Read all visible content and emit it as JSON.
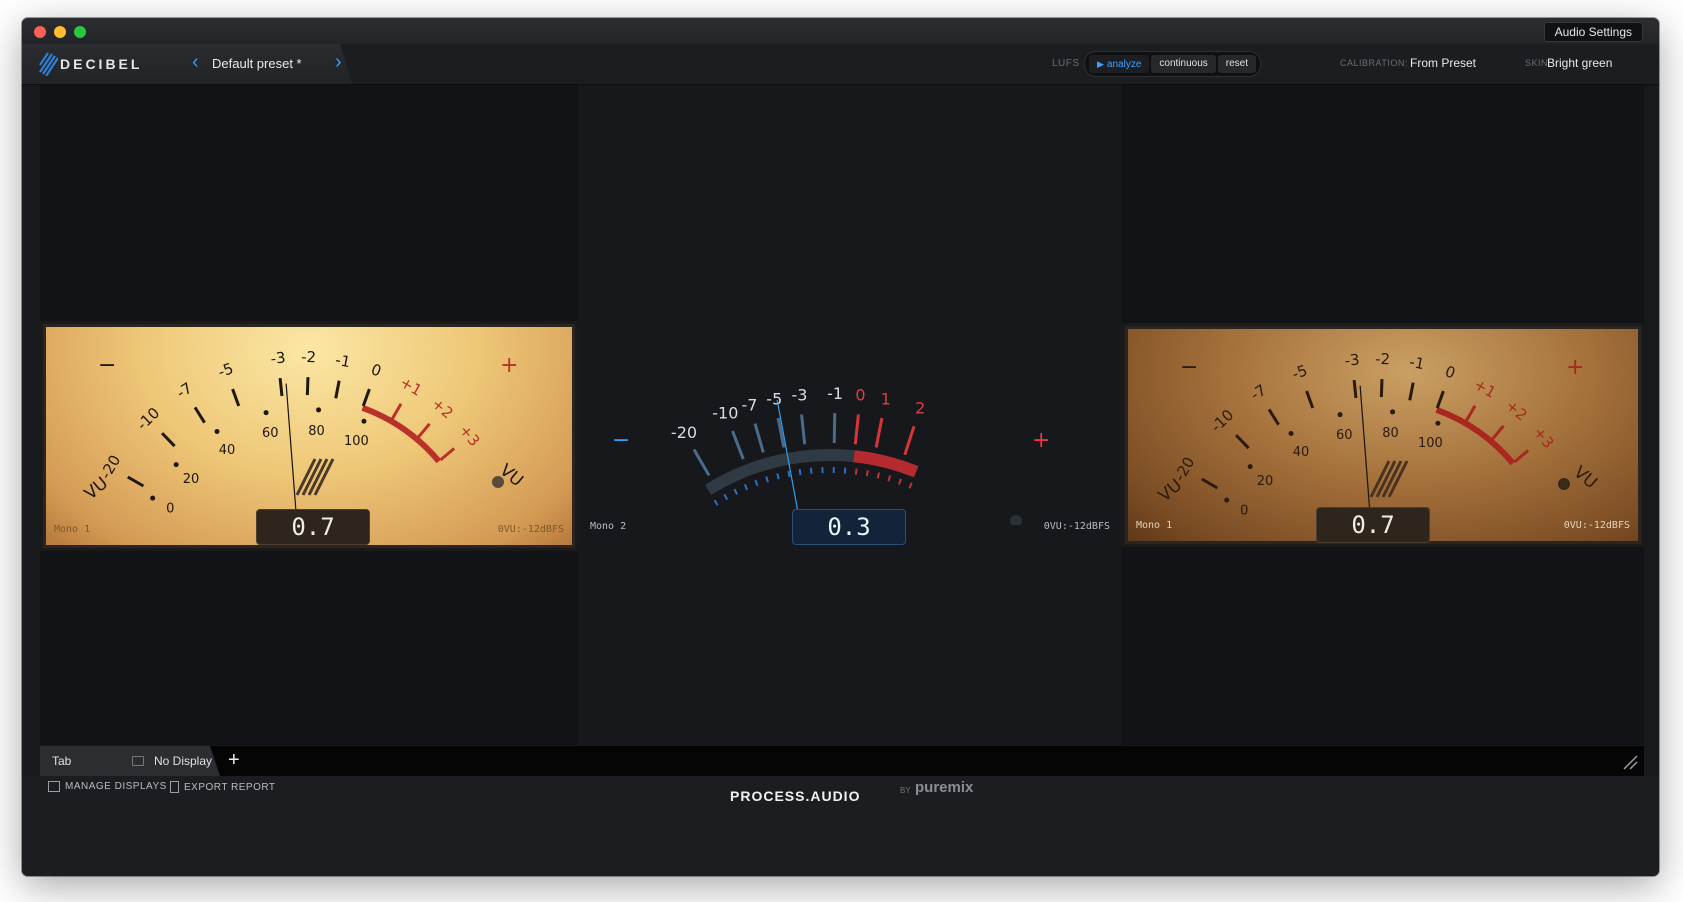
{
  "window": {
    "audio_settings_label": "Audio Settings"
  },
  "toolbar": {
    "logo_text": "DECIBEL",
    "preset_name": "Default preset *",
    "lufs_label": "LUFS",
    "lufs_buttons": [
      "analyze",
      "continuous",
      "reset"
    ],
    "calibration_label": "CALIBRATION:",
    "calibration_value": "From Preset",
    "skin_label": "SKIN:",
    "skin_value": "Bright green"
  },
  "meters": [
    {
      "style": "vintage-light",
      "name": "Mono 1",
      "calibration": "0VU:-12dBFS",
      "readout": "0.7",
      "vu_label": "VU",
      "minus": "−",
      "plus": "+",
      "scale_top": [
        "-20",
        "-10",
        "-7",
        "-5",
        "-3",
        "-2",
        "-1",
        "0",
        "+1",
        "+2",
        "+3"
      ],
      "scale_bottom": [
        "0",
        "20",
        "40",
        "60",
        "80",
        "100"
      ],
      "needle_value": -2.8
    },
    {
      "style": "modern-blue",
      "name": "Mono 2",
      "calibration": "0VU:-12dBFS",
      "readout": "0.3",
      "minus": "−",
      "plus": "+",
      "scale_top": [
        "-20",
        "-10",
        "-7",
        "-5",
        "-3",
        "-1",
        "0",
        "1",
        "2"
      ],
      "needle_value": -4.8
    },
    {
      "style": "vintage-dark",
      "name": "Mono 1",
      "calibration": "0VU:-12dBFS",
      "readout": "0.7",
      "vu_label": "VU",
      "minus": "−",
      "plus": "+",
      "scale_top": [
        "-20",
        "-10",
        "-7",
        "-5",
        "-3",
        "-2",
        "-1",
        "0",
        "+1",
        "+2",
        "+3"
      ],
      "scale_bottom": [
        "0",
        "20",
        "40",
        "60",
        "80",
        "100"
      ],
      "needle_value": -2.8
    }
  ],
  "tabs": {
    "tab_label": "Tab",
    "display_label": "No Display",
    "add_label": "+"
  },
  "footer": {
    "manage_displays": "MANAGE DISPLAYS",
    "export_report": "EXPORT REPORT",
    "brand": "PROCESS.AUDIO",
    "by": "BY",
    "partner": "puremix"
  },
  "colors": {
    "accent_blue": "#2f9ff0",
    "red": "#d12a2a",
    "vintage_red": "#b8322a"
  }
}
